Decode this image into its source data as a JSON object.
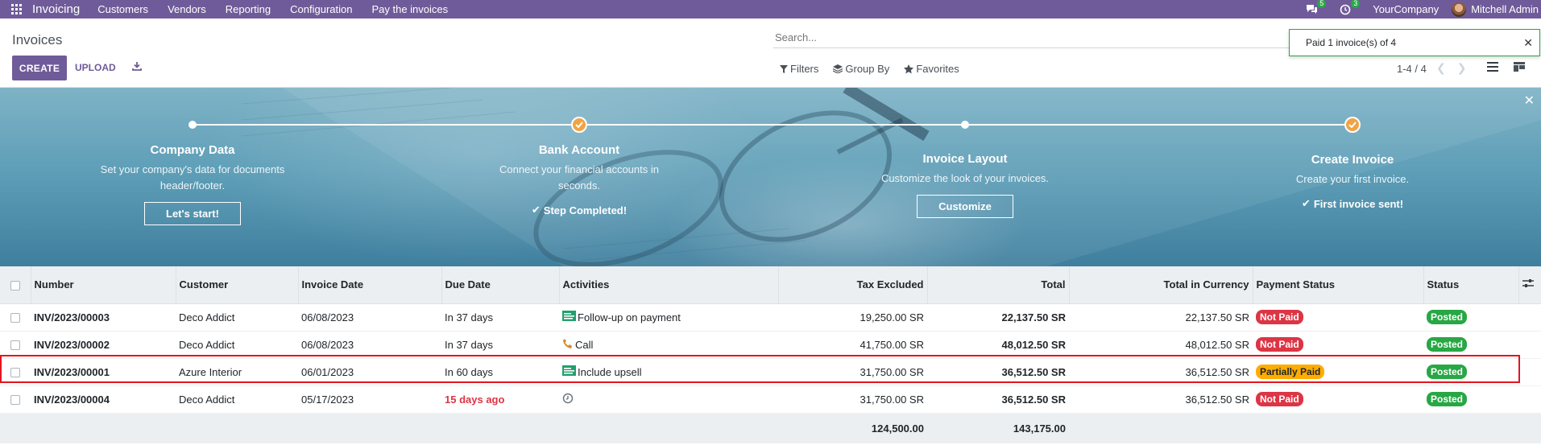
{
  "navbar": {
    "app_name": "Invoicing",
    "menu": [
      "Customers",
      "Vendors",
      "Reporting",
      "Configuration",
      "Pay the invoices"
    ],
    "messages_count": "5",
    "activities_count": "3",
    "company": "YourCompany",
    "user": "Mitchell Admin",
    "color": "#6f5b99"
  },
  "control_panel": {
    "title": "Invoices",
    "create_label": "CREATE",
    "upload_label": "UPLOAD",
    "search_placeholder": "Search...",
    "filters_label": "Filters",
    "groupby_label": "Group By",
    "favorites_label": "Favorites",
    "pager": "1-4 / 4"
  },
  "notification": {
    "text": "Paid 1 invoice(s) of 4"
  },
  "onboarding": {
    "steps": [
      {
        "title": "Company Data",
        "desc": "Set your company's data for documents header/footer.",
        "button": "Let's start!",
        "done": false
      },
      {
        "title": "Bank Account",
        "desc": "Connect your financial accounts in seconds.",
        "done_label": "Step Completed!",
        "done": true
      },
      {
        "title": "Invoice Layout",
        "desc": "Customize the look of your invoices.",
        "button": "Customize",
        "done": false
      },
      {
        "title": "Create Invoice",
        "desc": "Create your first invoice.",
        "done_label": "First invoice sent!",
        "done": true
      }
    ]
  },
  "table": {
    "headers": [
      "Number",
      "Customer",
      "Invoice Date",
      "Due Date",
      "Activities",
      "Tax Excluded",
      "Total",
      "Total in Currency",
      "Payment Status",
      "Status"
    ],
    "rows": [
      {
        "number": "INV/2023/00003",
        "customer": "Deco Addict",
        "invoice_date": "06/08/2023",
        "due_date": "In 37 days",
        "due_late": false,
        "activity": "Follow-up on payment",
        "activity_icon": "invoice-icon",
        "tax_excluded": "19,250.00 SR",
        "total": "22,137.50 SR",
        "total_currency": "22,137.50 SR",
        "payment_status": "Not Paid",
        "payment_color": "red",
        "status": "Posted"
      },
      {
        "number": "INV/2023/00002",
        "customer": "Deco Addict",
        "invoice_date": "06/08/2023",
        "due_date": "In 37 days",
        "due_late": false,
        "activity": "Call",
        "activity_icon": "phone-icon",
        "tax_excluded": "41,750.00 SR",
        "total": "48,012.50 SR",
        "total_currency": "48,012.50 SR",
        "payment_status": "Not Paid",
        "payment_color": "red",
        "status": "Posted"
      },
      {
        "number": "INV/2023/00001",
        "customer": "Azure Interior",
        "invoice_date": "06/01/2023",
        "due_date": "In 60 days",
        "due_late": false,
        "activity": "Include upsell",
        "activity_icon": "invoice-icon",
        "tax_excluded": "31,750.00 SR",
        "total": "36,512.50 SR",
        "total_currency": "36,512.50 SR",
        "payment_status": "Partially Paid",
        "payment_color": "yellow",
        "status": "Posted"
      },
      {
        "number": "INV/2023/00004",
        "customer": "Deco Addict",
        "invoice_date": "05/17/2023",
        "due_date": "15 days ago",
        "due_late": true,
        "activity": "",
        "activity_icon": "clock-icon",
        "tax_excluded": "31,750.00 SR",
        "total": "36,512.50 SR",
        "total_currency": "36,512.50 SR",
        "payment_status": "Not Paid",
        "payment_color": "red",
        "status": "Posted"
      }
    ],
    "footer": {
      "tax_excluded_sum": "124,500.00",
      "total_sum": "143,175.00"
    }
  }
}
